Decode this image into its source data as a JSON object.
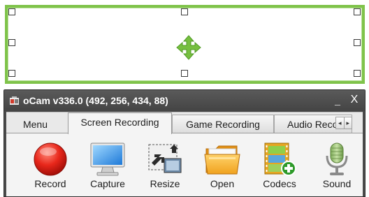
{
  "capture": {
    "frame_color": "#7fc34a",
    "move_icon": "move-arrows-icon"
  },
  "window": {
    "title": "oCam v336.0 (492, 256, 434, 88)",
    "minimize_label": "_",
    "close_label": "X"
  },
  "tabs": [
    {
      "label": "Menu"
    },
    {
      "label": "Screen Recording"
    },
    {
      "label": "Game Recording"
    },
    {
      "label": "Audio Reco"
    }
  ],
  "tab_scroll": {
    "left": "◂",
    "right": "▸"
  },
  "toolbar": {
    "record": {
      "label": "Record",
      "icon": "record-icon"
    },
    "capture": {
      "label": "Capture",
      "icon": "monitor-icon"
    },
    "resize": {
      "label": "Resize",
      "icon": "resize-icon"
    },
    "open": {
      "label": "Open",
      "icon": "folder-icon"
    },
    "codecs": {
      "label": "Codecs",
      "icon": "film-plus-icon"
    },
    "sound": {
      "label": "Sound",
      "icon": "microphone-icon"
    }
  }
}
